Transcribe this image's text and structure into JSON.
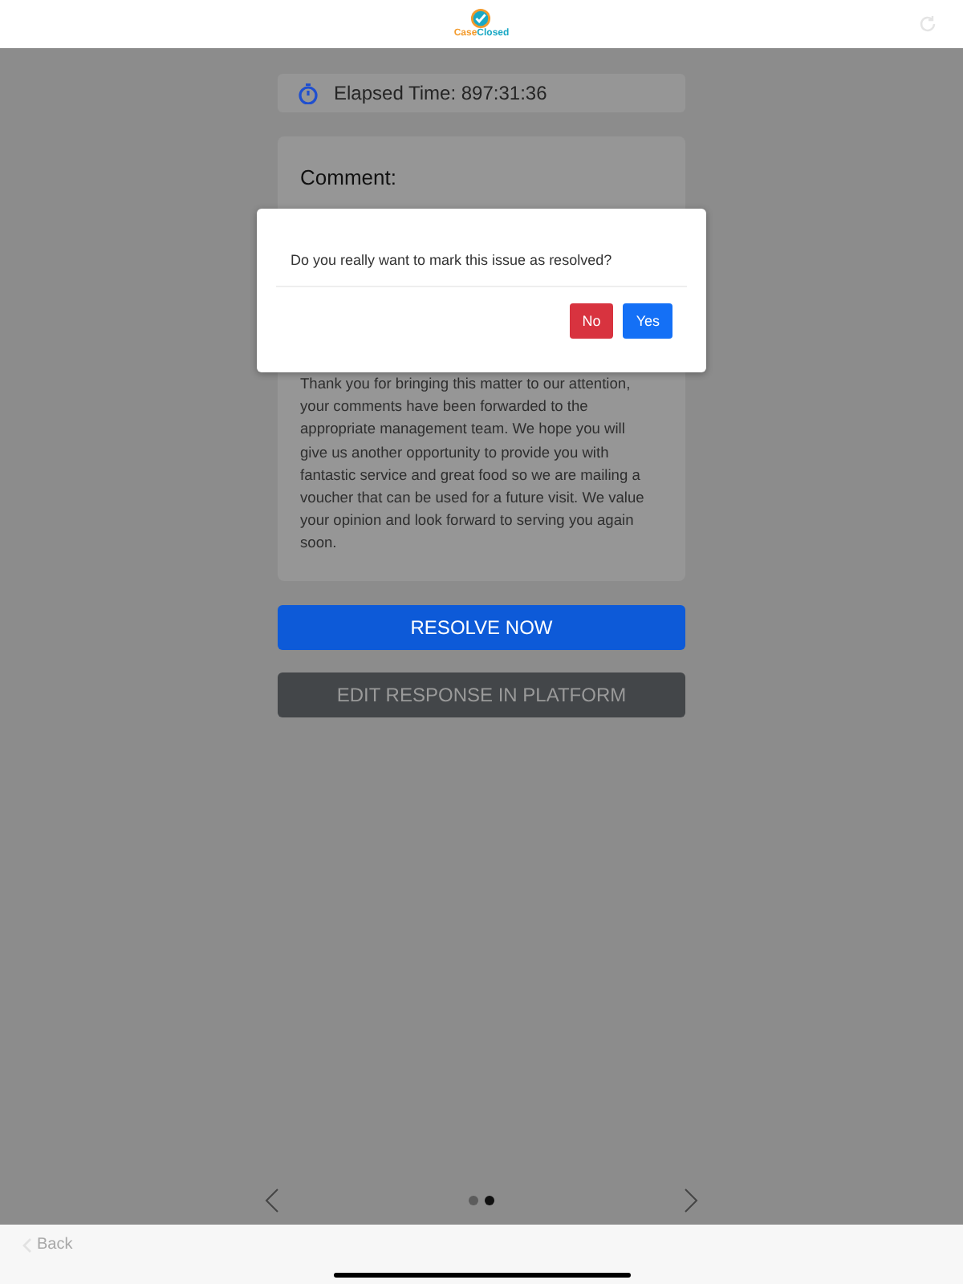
{
  "header": {
    "logo": [
      "Case",
      "Closed"
    ]
  },
  "timer": {
    "label": "Elapsed Time: 897:31:36"
  },
  "comment_card": {
    "heading": "Comment:",
    "response": "Thank you for bringing this matter to our attention, your comments have been forwarded to the appropriate management team. We hope you will give us another opportunity to provide you with fantastic service and great food so we are mailing a voucher that can be used for a future visit. We value your opinion and look forward to serving you again soon."
  },
  "actions": [
    {
      "label": "RESOLVE NOW",
      "kind": "primary"
    },
    {
      "label": "EDIT RESPONSE IN PLATFORM",
      "kind": "secondary"
    }
  ],
  "pager": [
    {
      "selected": false
    },
    {
      "selected": true
    }
  ],
  "bottom_bar": {
    "back": "Back"
  },
  "dialog": {
    "message": "Do you really want to mark this issue as resolved?",
    "buttons": [
      {
        "label": "No",
        "kind": "danger"
      },
      {
        "label": "Yes",
        "kind": "primary"
      }
    ]
  }
}
